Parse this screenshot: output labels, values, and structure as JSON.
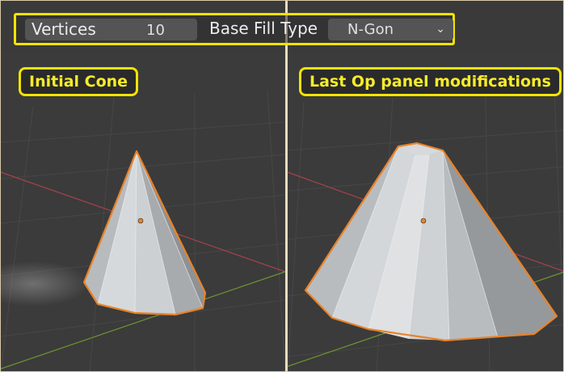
{
  "redo_panel": {
    "vertices_label": "Vertices",
    "vertices_value": "10",
    "base_fill_type_label": "Base Fill Type",
    "base_fill_type_value": "N-Gon"
  },
  "left_view": {
    "caption": "Initial Cone"
  },
  "right_view": {
    "caption": "Last Op panel modifications"
  },
  "colors": {
    "highlight": "#f2e300",
    "selection_outline": "#e8832a",
    "viewport_background": "#3a3a3a",
    "x_axis": "#a8424a",
    "y_axis": "#6c9632"
  }
}
